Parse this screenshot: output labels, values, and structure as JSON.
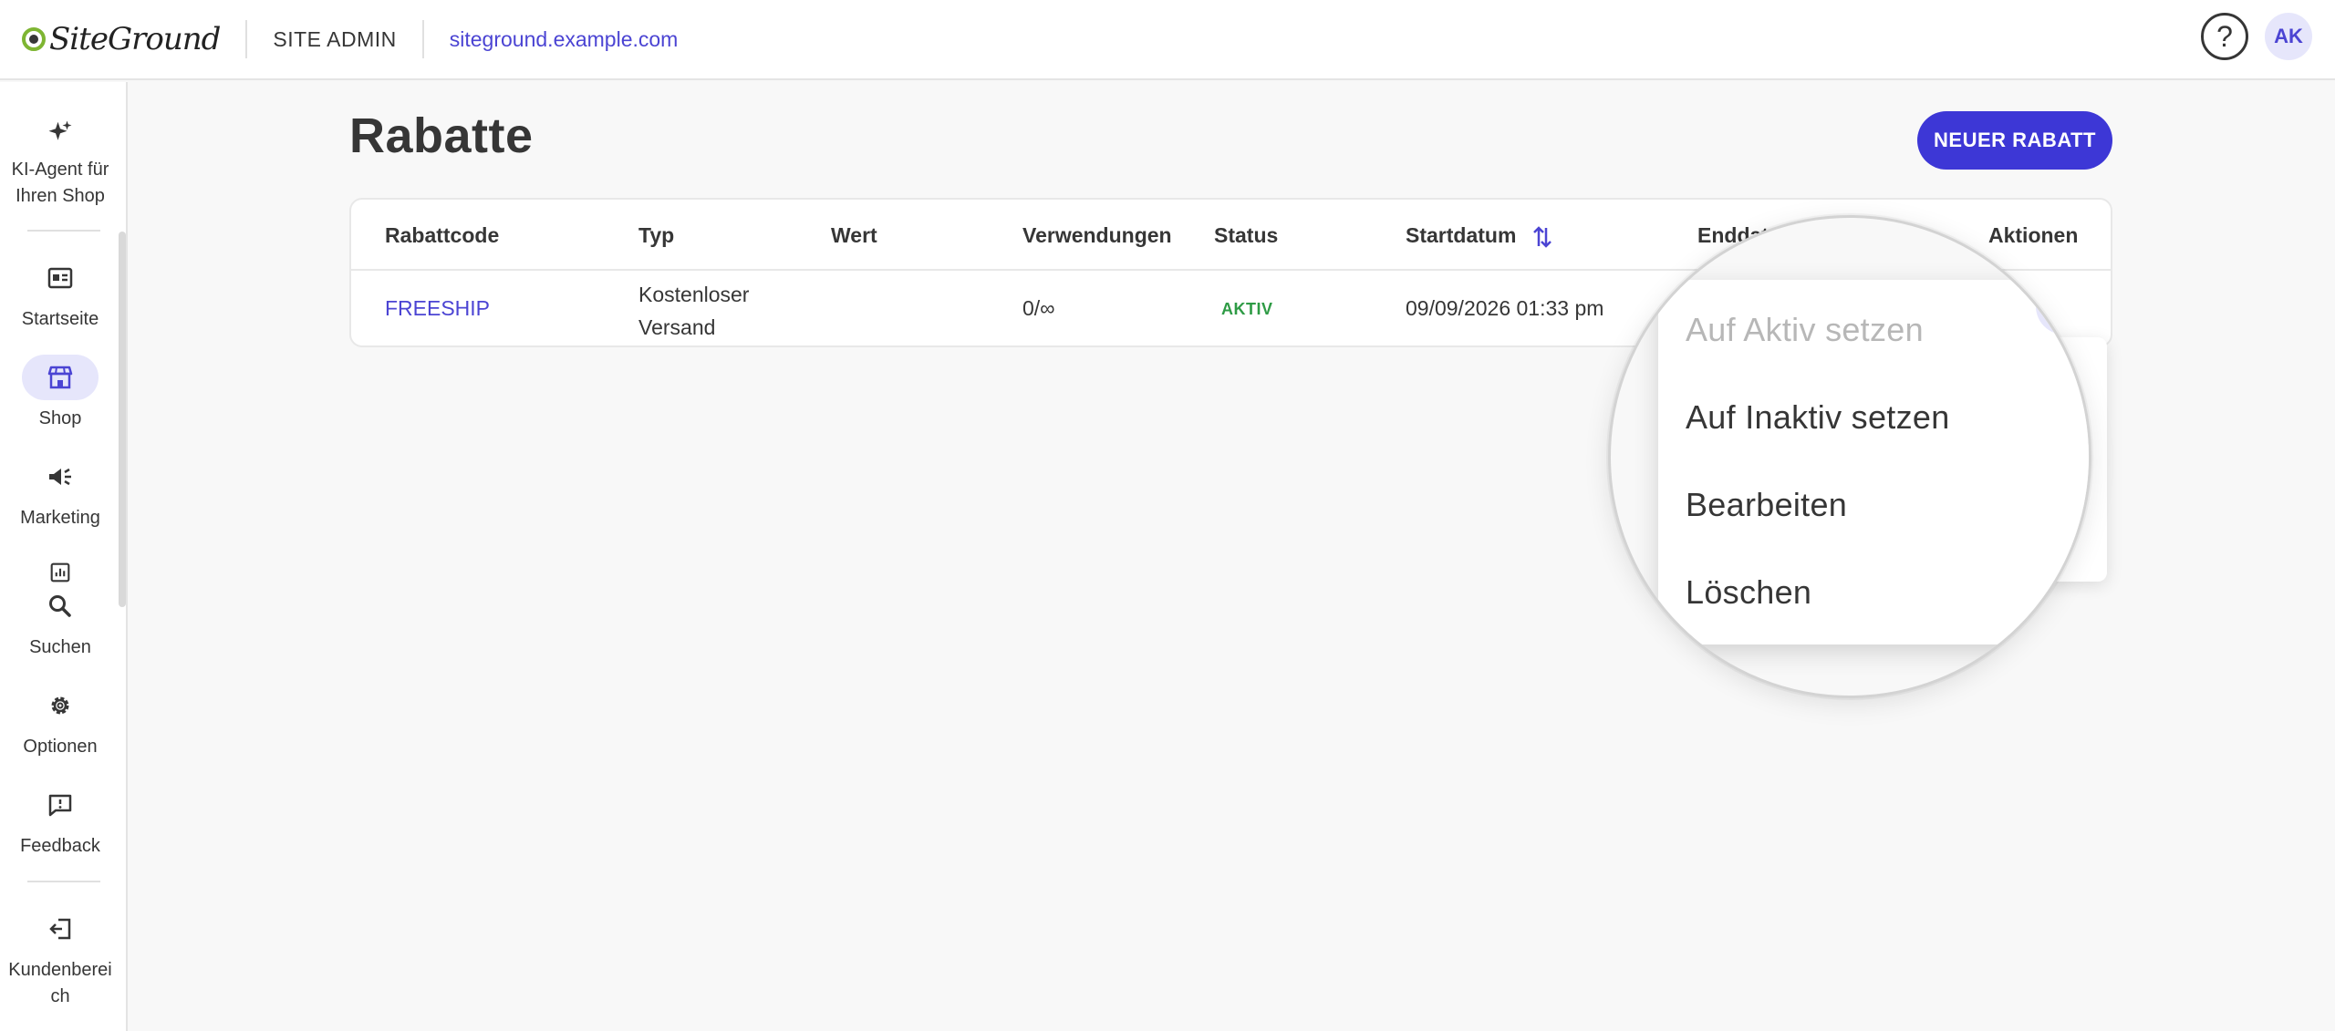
{
  "header": {
    "logo_text": "SiteGround",
    "section": "SITE ADMIN",
    "site_url": "siteground.example.com",
    "help_label": "?",
    "avatar_initials": "AK"
  },
  "sidebar": {
    "items": [
      {
        "label": "KI-Agent für Ihren Shop",
        "icon": "sparkle-icon"
      },
      {
        "label": "Startseite",
        "icon": "home-dashboard-icon"
      },
      {
        "label": "Shop",
        "icon": "store-icon",
        "active": true
      },
      {
        "label": "Marketing",
        "icon": "megaphone-icon"
      },
      {
        "label": "Suchen",
        "icon": "search-icon"
      },
      {
        "label": "Optionen",
        "icon": "gear-icon"
      },
      {
        "label": "Feedback",
        "icon": "feedback-icon"
      },
      {
        "label": "Kundenbereich",
        "icon": "exit-icon"
      }
    ]
  },
  "page": {
    "title": "Rabatte",
    "new_button": "NEUER RABATT"
  },
  "table": {
    "columns": [
      "Rabattcode",
      "Typ",
      "Wert",
      "Verwendungen",
      "Status",
      "Startdatum",
      "Enddat",
      "Aktionen"
    ],
    "rows": [
      {
        "code": "FREESHIP",
        "type_line1": "Kostenloser",
        "type_line2": "Versand",
        "value": "",
        "usage": "0/∞",
        "status": "AKTIV",
        "start": "09/09/2026 01:33 pm"
      }
    ]
  },
  "action_menu": {
    "items": [
      {
        "label": "Auf Aktiv setzen",
        "disabled": true
      },
      {
        "label": "Auf Inaktiv setzen",
        "disabled": false
      },
      {
        "label": "Bearbeiten",
        "disabled": false
      },
      {
        "label": "Löschen",
        "disabled": false
      }
    ]
  },
  "colors": {
    "accent": "#3d37d6",
    "link": "#4b44d3",
    "status_active": "#2e9b45",
    "logo_green": "#7eb532"
  }
}
